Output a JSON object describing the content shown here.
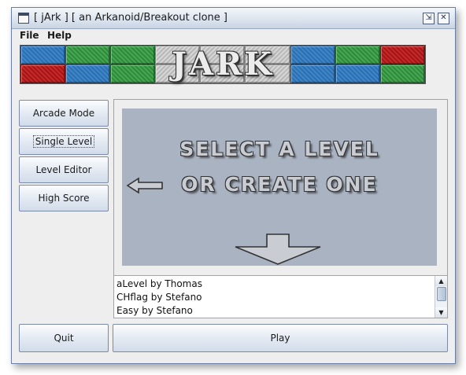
{
  "window": {
    "title": "[ jArk ] [ an Arkanoid/Breakout clone ]",
    "maximize_glyph": "⇲",
    "close_glyph": "✕"
  },
  "menu": [
    "File",
    "Help"
  ],
  "banner": {
    "logo": "JARK",
    "bricks_top": [
      "blue",
      "green",
      "green",
      "stone",
      "stone",
      "stone",
      "blue",
      "green",
      "red"
    ],
    "bricks_bottom": [
      "red",
      "blue",
      "green",
      "stone",
      "stone",
      "stone",
      "blue",
      "blue",
      "green"
    ]
  },
  "sidebar": {
    "buttons": [
      "Arcade Mode",
      "Single Level",
      "Level Editor",
      "High Score"
    ],
    "selected": "Single Level"
  },
  "preview": {
    "line1": "SELECT A LEVEL",
    "line2": "OR CREATE ONE"
  },
  "levels": [
    "aLevel by Thomas",
    "CHflag by Stefano",
    "Easy by Stefano"
  ],
  "bottom": {
    "quit_label": "Quit",
    "play_label": "Play"
  },
  "colors": {
    "preview_bg": "#aab3c2",
    "window_bg": "#eeeeee",
    "brick_blue": "#3c86c9",
    "brick_green": "#45a653",
    "brick_red": "#c82828"
  }
}
